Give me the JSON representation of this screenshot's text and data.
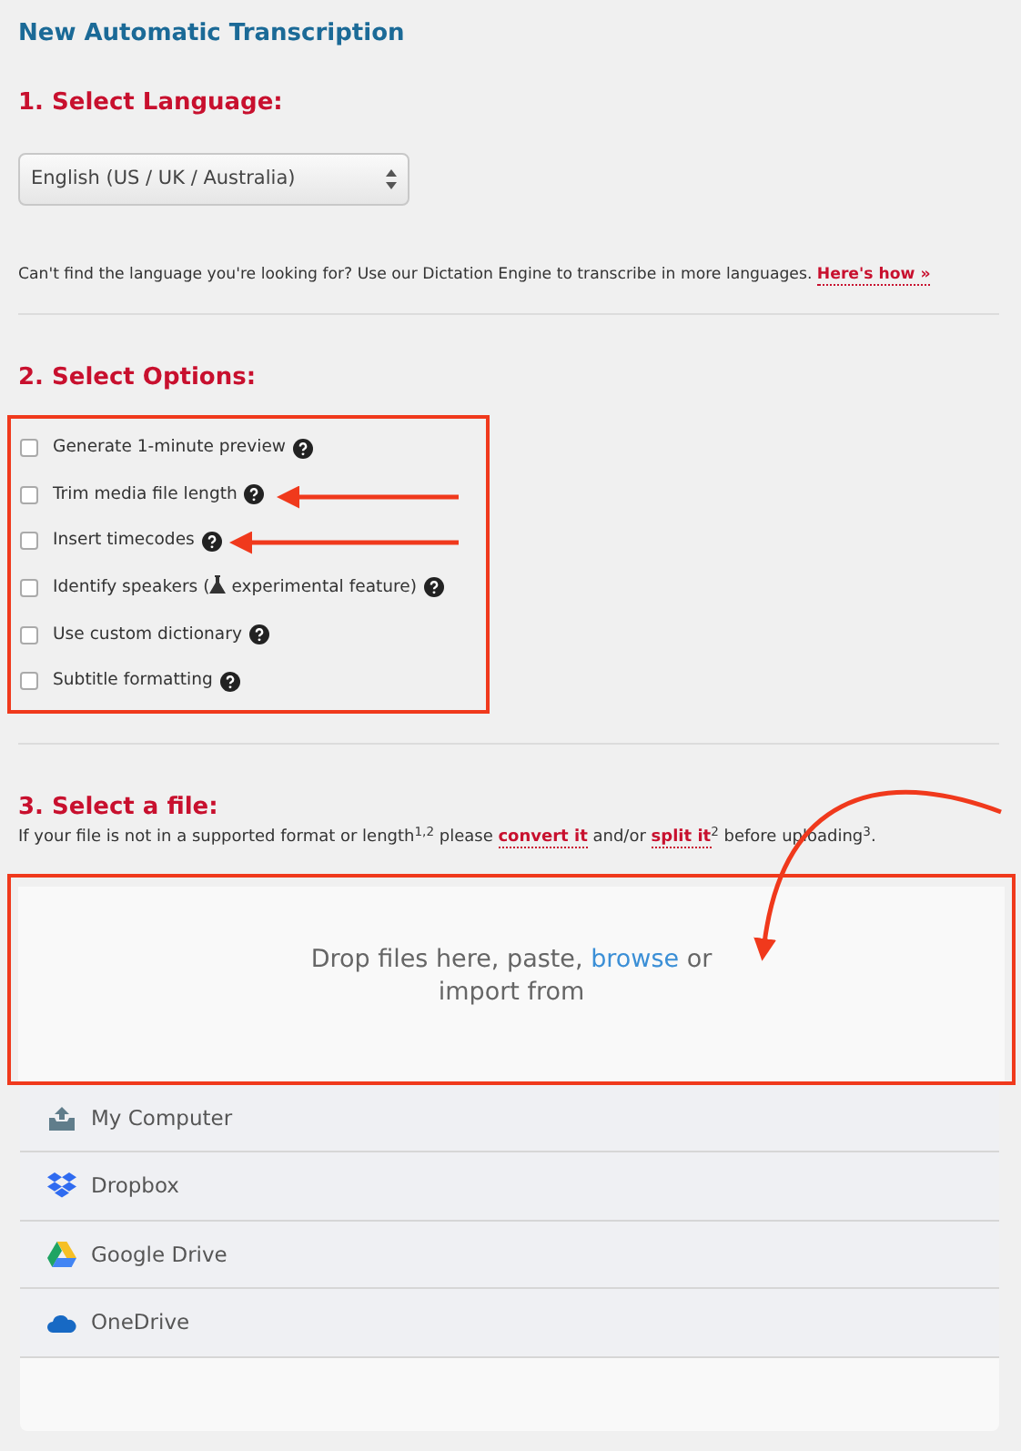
{
  "title": "New Automatic Transcription",
  "language_section": {
    "heading": "1. Select Language:",
    "select": {
      "value": "English (US / UK / Australia)"
    },
    "note": "Can't find the language you're looking for? Use our Dictation Engine to transcribe in more languages.",
    "note_link": "Here's how »"
  },
  "options_section": {
    "heading": "2. Select Options:",
    "options": [
      {
        "label": "Generate 1-minute preview",
        "checked": false
      },
      {
        "label": "Trim media file length",
        "checked": false
      },
      {
        "label": "Insert timecodes",
        "checked": false
      },
      {
        "label": "Identify speakers (",
        "label_after": " experimental feature)",
        "checked": false
      },
      {
        "label": "Use custom dictionary",
        "checked": false
      },
      {
        "label": "Subtitle formatting",
        "checked": false
      }
    ]
  },
  "file_section": {
    "heading": "3. Select a file:",
    "note": [
      {
        "kind": "text",
        "text": "If your file is not in a supported format or length$^{1,2}$ please "
      },
      {
        "kind": "link",
        "text": "convert it"
      },
      {
        "kind": "text",
        "text": " and/or "
      },
      {
        "kind": "link",
        "text": "split it"
      },
      {
        "kind": "text",
        "text": "$^{2}$ before uploading$^{3}$."
      }
    ],
    "drop": {
      "before": "Drop files here, paste,",
      "link": "browse",
      "after": "or import from"
    },
    "sources": [
      {
        "kind": "computer",
        "label": "My Computer"
      },
      {
        "kind": "dropbox",
        "label": "Dropbox"
      },
      {
        "kind": "gdrive",
        "label": "Google Drive"
      },
      {
        "kind": "onedrive",
        "label": "OneDrive"
      }
    ]
  }
}
